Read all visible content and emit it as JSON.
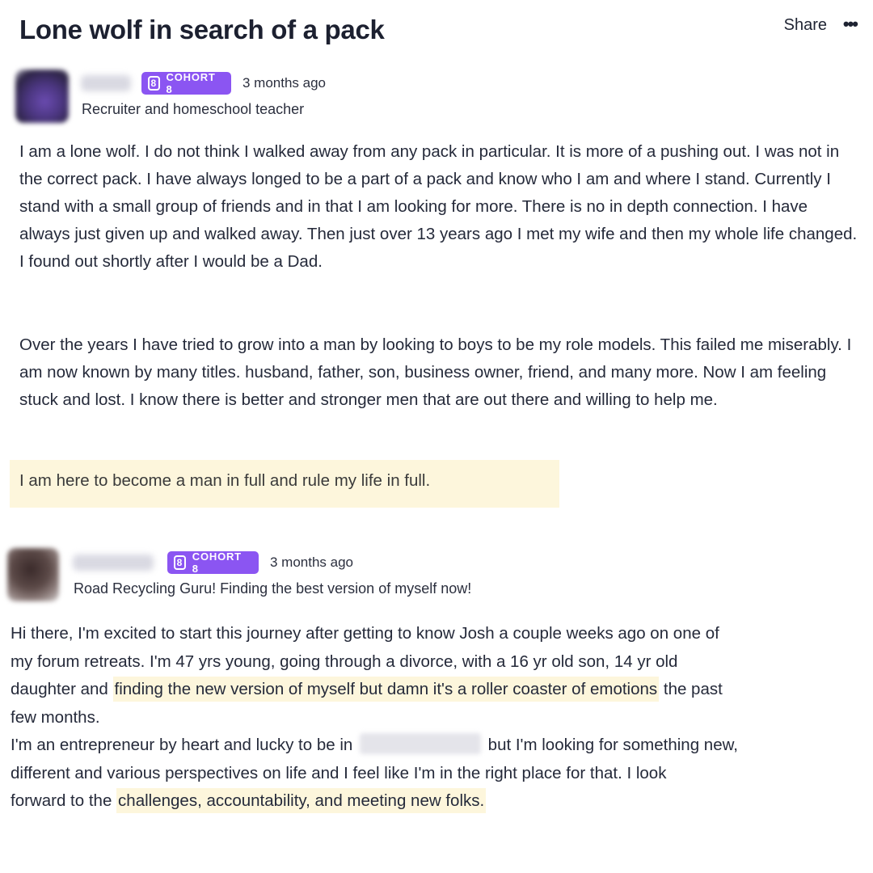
{
  "page": {
    "title": "Lone wolf in search of a pack",
    "share_label": "Share",
    "more_label": "•••"
  },
  "posts": [
    {
      "badge": "COHORT 8",
      "badge_icon": "8",
      "time": "3 months ago",
      "bio": "Recruiter and homeschool teacher",
      "paragraphs": [
        "I am a lone wolf. I do not think I walked away from any pack in particular. It is more of a pushing out. I was not in the correct pack. I have always longed to be a part of a pack and know who I am and where I stand. Currently I stand with a small group of friends and in that I am looking for more. There is no in depth connection. I have always just given up and walked away. Then just over 13 years ago I met my wife and then my whole life changed. I found out shortly after I would be a Dad.",
        "Over the years I have tried to grow into a man by looking to boys to be my role models. This failed me miserably. I am now known by many titles. husband, father, son, business owner, friend, and many more. Now I am feeling stuck and lost. I know there is better and stronger men that are out there and willing to help me."
      ],
      "highlight": "I am here to become a man in full and rule my life in full."
    },
    {
      "badge": "COHORT 8",
      "badge_icon": "8",
      "time": "3 months ago",
      "bio": "Road Recycling Guru! Finding the best version of myself now!",
      "text": {
        "l1": "Hi there, I'm excited to start this journey after getting to know Josh a couple weeks ago on one of",
        "l2": "my forum retreats.  I'm 47 yrs young, going through a divorce, with a 16 yr old son, 14 yr old",
        "l3_pre": "daughter and ",
        "l3_hl": "finding the new version of myself but damn it's a roller coaster of emotions",
        "l3_post": " the past",
        "l4": "few months.",
        "l5_pre": "I'm an entrepreneur by heart and lucky to be in ",
        "l5_post": " but I'm looking for something new,",
        "l6": "different and various perspectives on life and I feel like I'm in the right place for that.   I look",
        "l7_pre": "forward to the ",
        "l7_hl": "challenges, accountability, and meeting new folks."
      }
    }
  ]
}
